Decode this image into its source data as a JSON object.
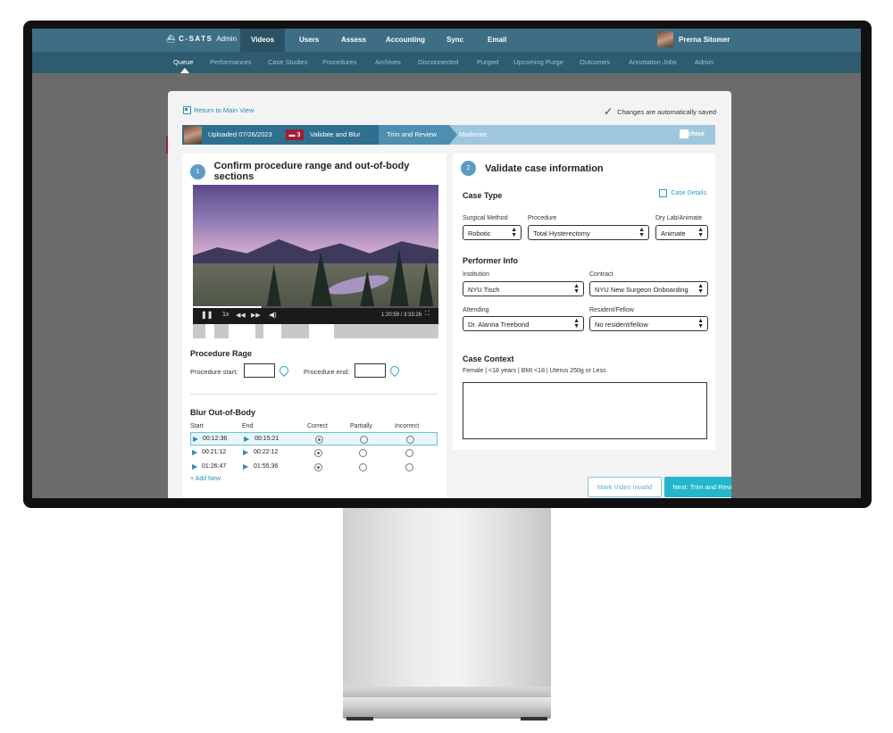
{
  "topnav": {
    "brand": "C-SATS",
    "brand_suffix": "Admin",
    "items": [
      "Videos",
      "Users",
      "Assess",
      "Accounting",
      "Sync",
      "Email"
    ],
    "user_name": "Prerna Sitomer"
  },
  "subnav": {
    "items": [
      "Queue",
      "Performances",
      "Case Studies",
      "Procedures",
      "Archives",
      "Disconnected",
      "Purged",
      "Upcoming Purge",
      "Outcomes",
      "Annotation Jobs",
      "Admin"
    ],
    "active": "Queue"
  },
  "modal": {
    "return_link": "Return to Main View",
    "saved_status": "Changes are automatically saved",
    "progress": {
      "uploaded": "Uploaded 07/26/2023",
      "flag_count": "3",
      "steps": [
        "Validate and Blur",
        "Trim and Review",
        "Moderate"
      ],
      "archive_label": "Archive"
    },
    "left": {
      "step_number": "1",
      "title": "Confirm procedure range and out-of-body sections",
      "video": {
        "speed": "1x",
        "time": "1:20:59 / 3:33:26",
        "progress": 0.28
      },
      "procedure_range_title": "Procedure Rage",
      "procedure_start_label": "Procedure start:",
      "procedure_end_label": "Procedure end:",
      "blur_title": "Blur Out-of-Body",
      "columns": [
        "Start",
        "End",
        "Correct",
        "Partially",
        "Incorrect"
      ],
      "rows": [
        {
          "start": "00:12:36",
          "end": "00:15:21",
          "selected": "Correct"
        },
        {
          "start": "00:21:12",
          "end": "00:22:12",
          "selected": "Correct"
        },
        {
          "start": "01:26:47",
          "end": "01:55:36",
          "selected": "Correct"
        }
      ],
      "add_new": "+ Add New"
    },
    "right": {
      "step_number": "2",
      "title": "Validate case information",
      "case_type_title": "Case Type",
      "case_details_link": "Case Details",
      "surgical_method_label": "Surgical Method",
      "surgical_method_value": "Robotic",
      "procedure_label": "Procedure",
      "procedure_value": "Total Hysterectomy",
      "drylab_label": "Dry Lab/Animate",
      "drylab_value": "Animate",
      "performer_title": "Performer Info",
      "institution_label": "Institution",
      "institution_value": "NYU Tisch",
      "contract_label": "Contract",
      "contract_value": "NYU New Surgeon Onboarding",
      "attending_label": "Attending",
      "attending_value": "Dr. Alanna Treebond",
      "resident_label": "Resident/Fellow",
      "resident_value": "No resident/fellow",
      "context_title": "Case Context",
      "context_text": "Female | <18 years | BMI <18 | Uterus 250g or Less"
    },
    "buttons": {
      "invalid": "Mark Video invalid",
      "next": "Next: Trim and Review"
    }
  },
  "colors": {
    "topnav": "#3d6e85",
    "subnav": "#2e5b70",
    "accent": "#22b7cc",
    "flag": "#a01d35",
    "progress_done": "#2f6f8f"
  }
}
